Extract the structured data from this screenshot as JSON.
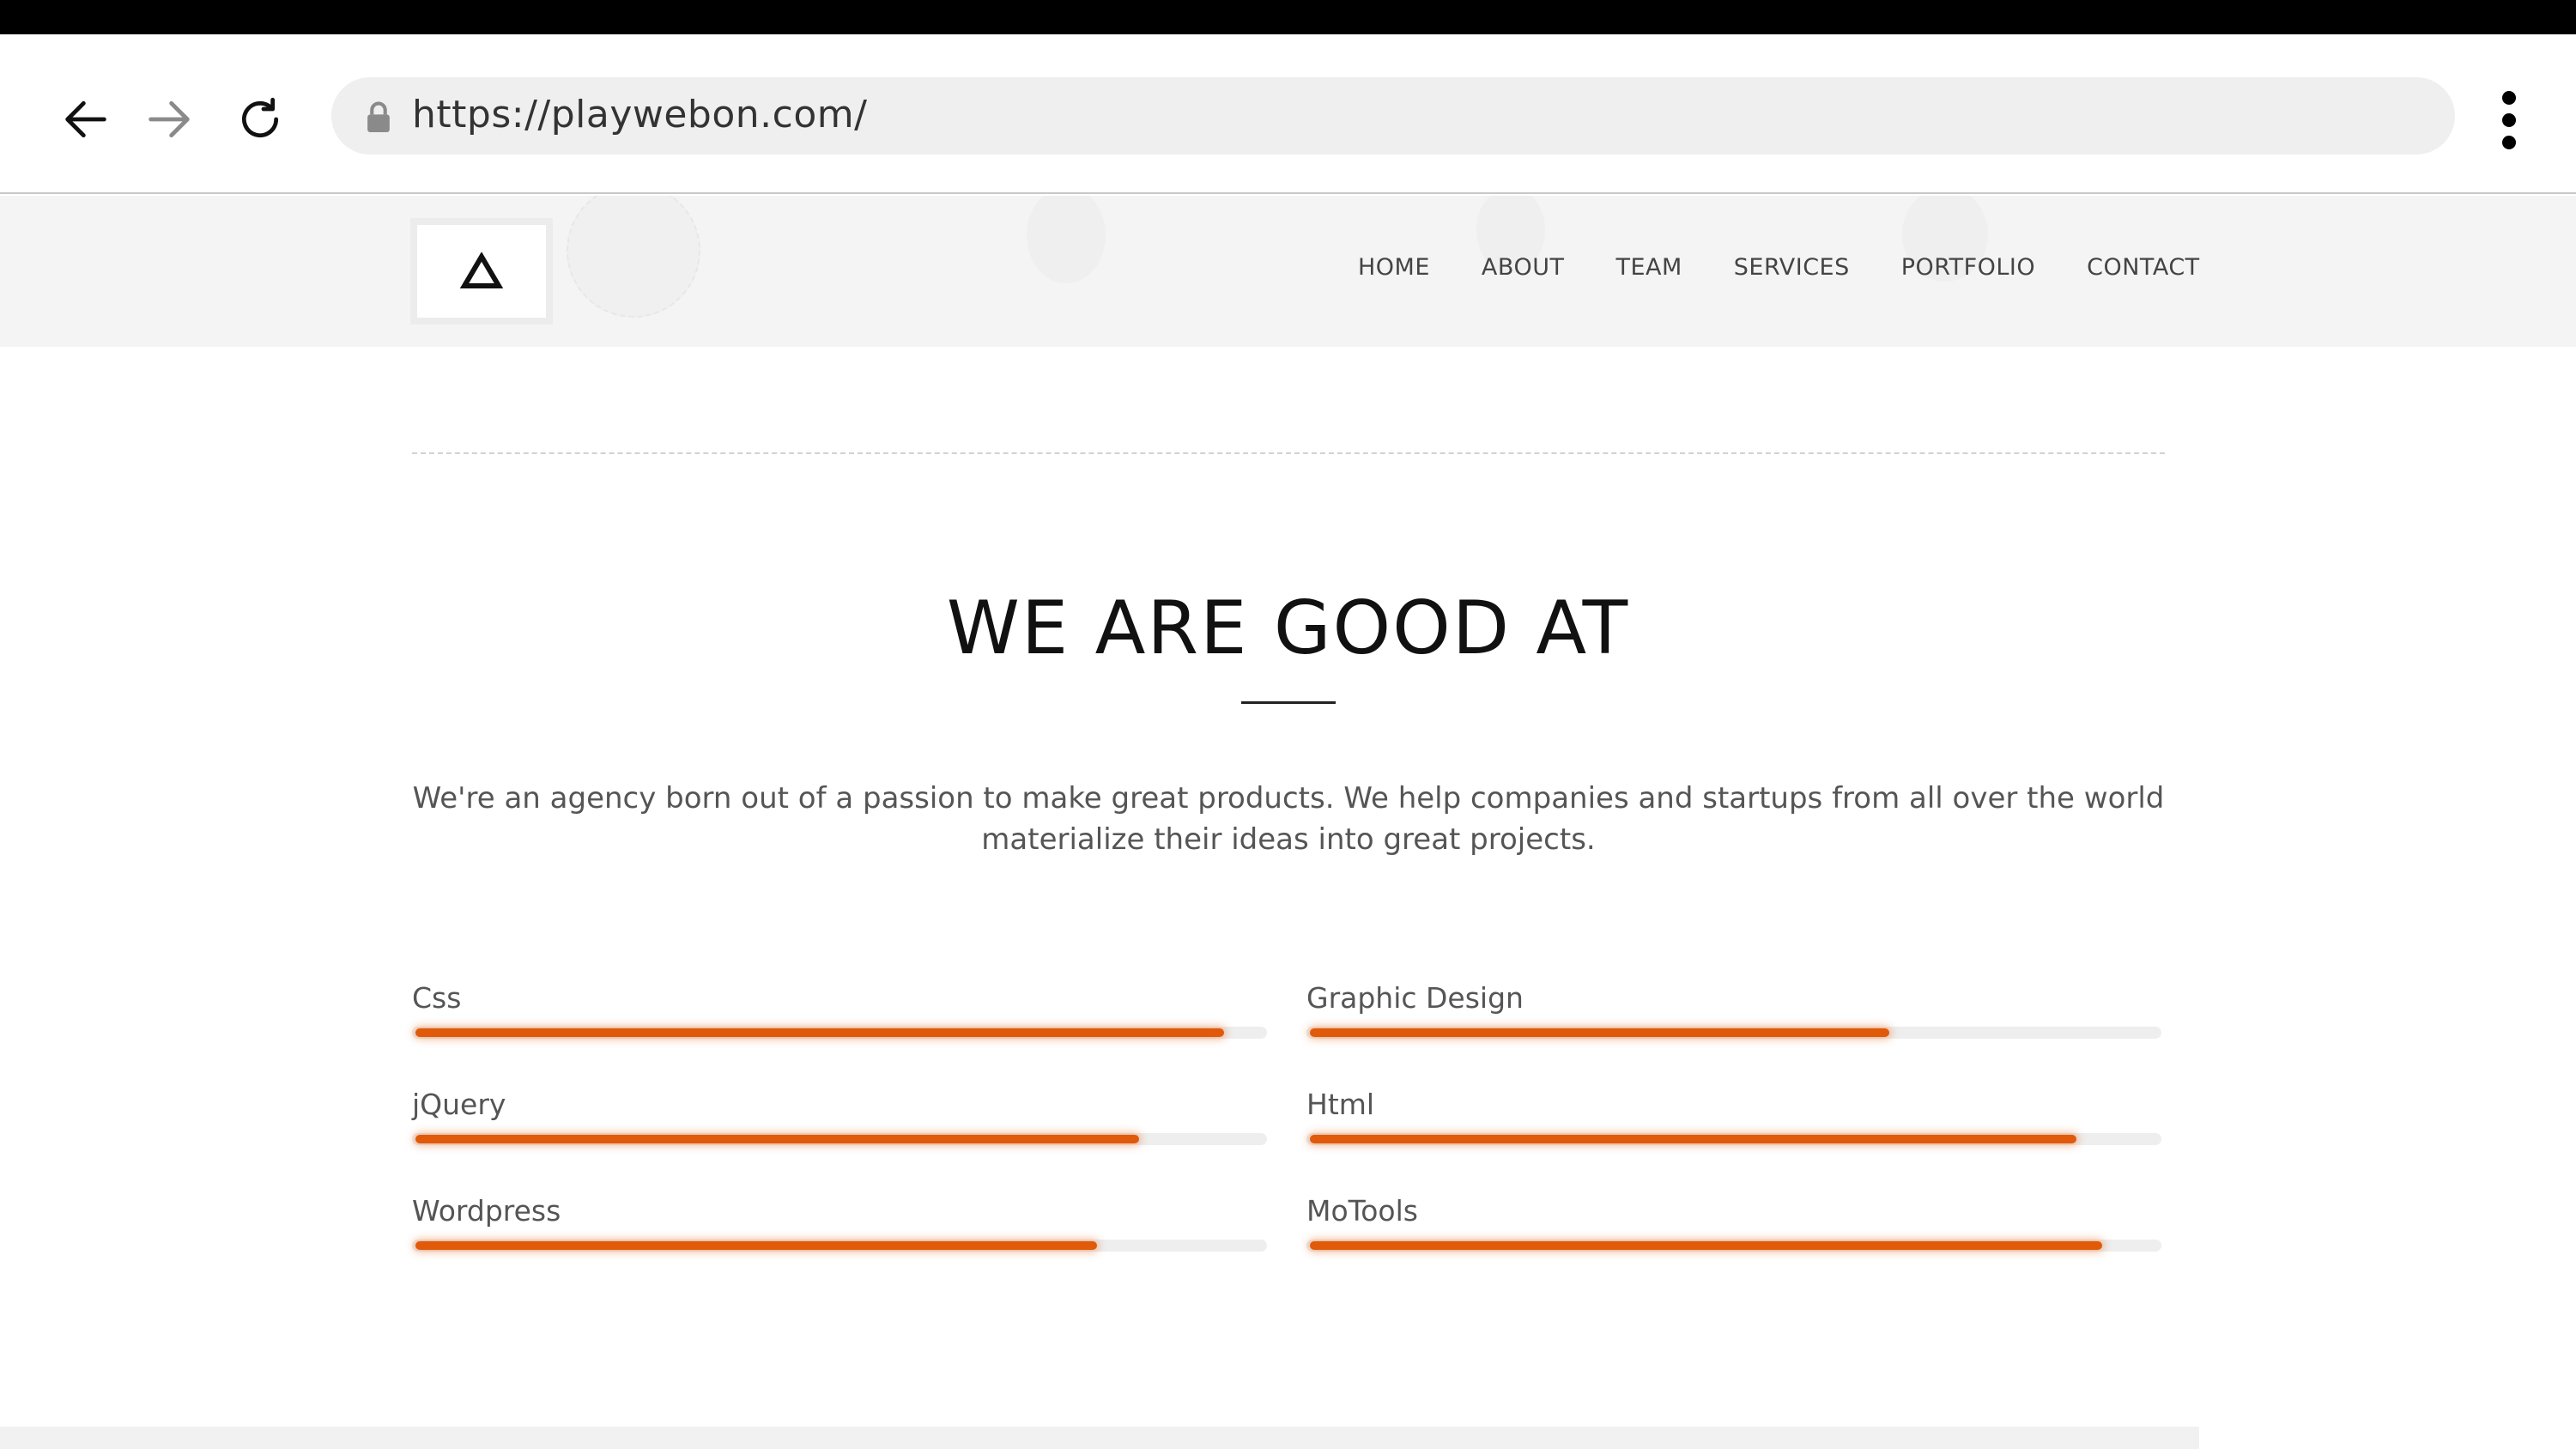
{
  "browser": {
    "url": "https://playwebon.com/",
    "icons": {
      "back": "arrow-left-icon",
      "forward": "arrow-right-icon",
      "reload": "reload-icon",
      "lock": "lock-icon",
      "menu": "kebab-menu-icon"
    }
  },
  "header": {
    "logo_icon": "triangle-logo-icon",
    "nav": [
      "HOME",
      "ABOUT",
      "TEAM",
      "SERVICES",
      "PORTFOLIO",
      "CONTACT"
    ]
  },
  "section": {
    "title": "WE ARE GOOD AT",
    "intro": "We're an agency born out of a passion to make great products. We help companies and startups from all over the world materialize their ideas into great projects."
  },
  "skills": [
    {
      "label": "Css",
      "level": 0.95
    },
    {
      "label": "Graphic Design",
      "level": 0.68
    },
    {
      "label": "jQuery",
      "level": 0.85
    },
    {
      "label": "Html",
      "level": 0.9
    },
    {
      "label": "Wordpress",
      "level": 0.8
    },
    {
      "label": "MoTools",
      "level": 0.93
    }
  ],
  "colors": {
    "accent": "#e05a0a",
    "track": "#eeeeee",
    "header_bg": "#f4f4f4"
  }
}
